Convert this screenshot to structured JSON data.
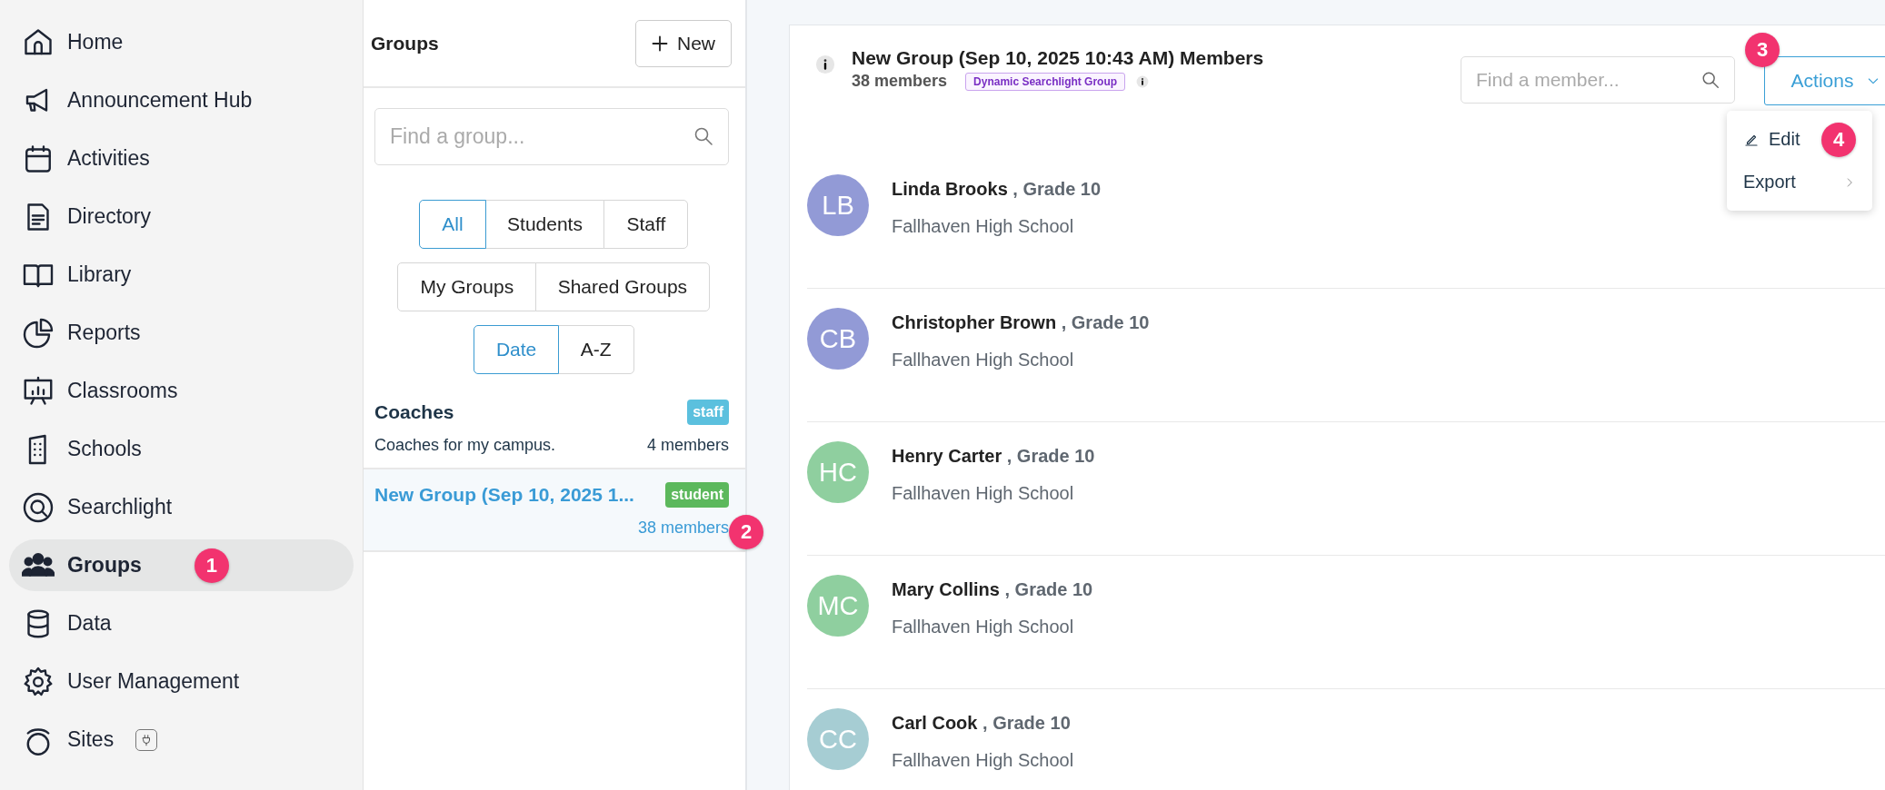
{
  "sidebar": {
    "items": [
      {
        "label": "Home",
        "selected": false
      },
      {
        "label": "Announcement Hub",
        "selected": false
      },
      {
        "label": "Activities",
        "selected": false
      },
      {
        "label": "Directory",
        "selected": false
      },
      {
        "label": "Library",
        "selected": false
      },
      {
        "label": "Reports",
        "selected": false
      },
      {
        "label": "Classrooms",
        "selected": false
      },
      {
        "label": "Schools",
        "selected": false
      },
      {
        "label": "Searchlight",
        "selected": false
      },
      {
        "label": "Groups",
        "selected": true,
        "marker": "1"
      },
      {
        "label": "Data",
        "selected": false
      },
      {
        "label": "User Management",
        "selected": false
      },
      {
        "label": "Sites",
        "selected": false
      }
    ]
  },
  "groups_panel": {
    "title": "Groups",
    "new_button": "New",
    "search": {
      "placeholder": "Find a group..."
    },
    "filter_rows": [
      [
        {
          "label": "All",
          "selected": true
        },
        {
          "label": "Students",
          "selected": false
        },
        {
          "label": "Staff",
          "selected": false
        }
      ],
      [
        {
          "label": "My Groups",
          "selected": false
        },
        {
          "label": "Shared Groups",
          "selected": false
        }
      ],
      [
        {
          "label": "Date",
          "selected": true
        },
        {
          "label": "A-Z",
          "selected": false
        }
      ]
    ],
    "groups": [
      {
        "name": "Coaches",
        "description": "Coaches for my campus.",
        "tag": "staff",
        "color": "#5bc0de",
        "members": "4 members",
        "selected": false
      },
      {
        "name": "New Group (Sep 10, 2025 1...",
        "tag": "student",
        "color": "#5cb85c",
        "members": "38 members",
        "selected": true,
        "marker": "2"
      }
    ]
  },
  "members_view": {
    "title": "New Group (Sep 10, 2025 10:43 AM) Members",
    "count": "38 members",
    "tag": "Dynamic Searchlight Group",
    "search": {
      "placeholder": "Find a member..."
    },
    "actions": {
      "label": "Actions",
      "expanded": true,
      "marker": "3"
    },
    "menu": [
      {
        "label": "Edit",
        "kind": "edit",
        "marker": "4"
      },
      {
        "label": "Export",
        "kind": "submenu"
      }
    ],
    "members": [
      {
        "initials": "LB",
        "color": "#929ad6",
        "name": "Linda Brooks",
        "grade": ", Grade 10",
        "school": "Fallhaven High School"
      },
      {
        "initials": "CB",
        "color": "#929ad6",
        "name": "Christopher Brown",
        "grade": ", Grade 10",
        "school": "Fallhaven High School"
      },
      {
        "initials": "HC",
        "color": "#8fcf9f",
        "name": "Henry Carter",
        "grade": ", Grade 10",
        "school": "Fallhaven High School"
      },
      {
        "initials": "MC",
        "color": "#8fcf9f",
        "name": "Mary Collins",
        "grade": ", Grade 10",
        "school": "Fallhaven High School"
      },
      {
        "initials": "CC",
        "color": "#a6cdd3",
        "name": "Carl Cook",
        "grade": ", Grade 10",
        "school": "Fallhaven High School"
      }
    ]
  }
}
